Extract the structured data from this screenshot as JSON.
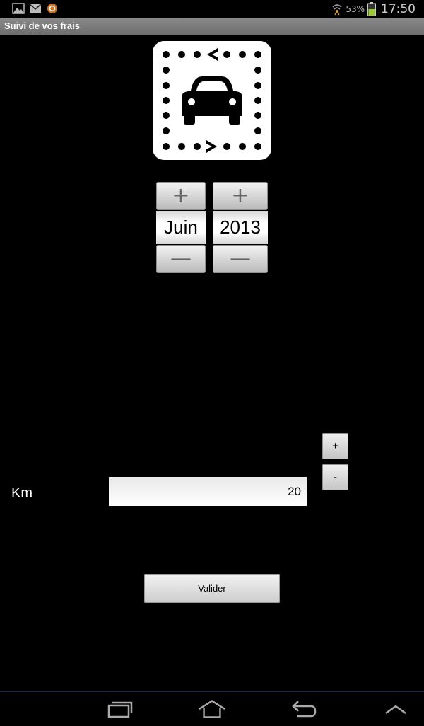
{
  "status_bar": {
    "battery_percent": "53%",
    "time": "17:50",
    "icons": [
      "gallery-icon",
      "gmail-icon",
      "sync-app-icon",
      "wifi-icon",
      "battery-icon"
    ]
  },
  "app": {
    "title": "Suivi de vos frais",
    "logo_icon": "car-route-icon"
  },
  "date_picker": {
    "month": "Juin",
    "year": "2013",
    "increment_symbol": "+",
    "decrement_symbol": "—"
  },
  "km": {
    "label": "Km",
    "value": "20",
    "plus_label": "+",
    "minus_label": "-"
  },
  "actions": {
    "validate_label": "Valider"
  },
  "nav_bar": {
    "icons": [
      "recent-apps-icon",
      "home-icon",
      "back-icon",
      "menu-up-icon"
    ]
  },
  "colors": {
    "background": "#000000",
    "title_bar": "#7a7a7a",
    "battery": "#9acd32"
  }
}
